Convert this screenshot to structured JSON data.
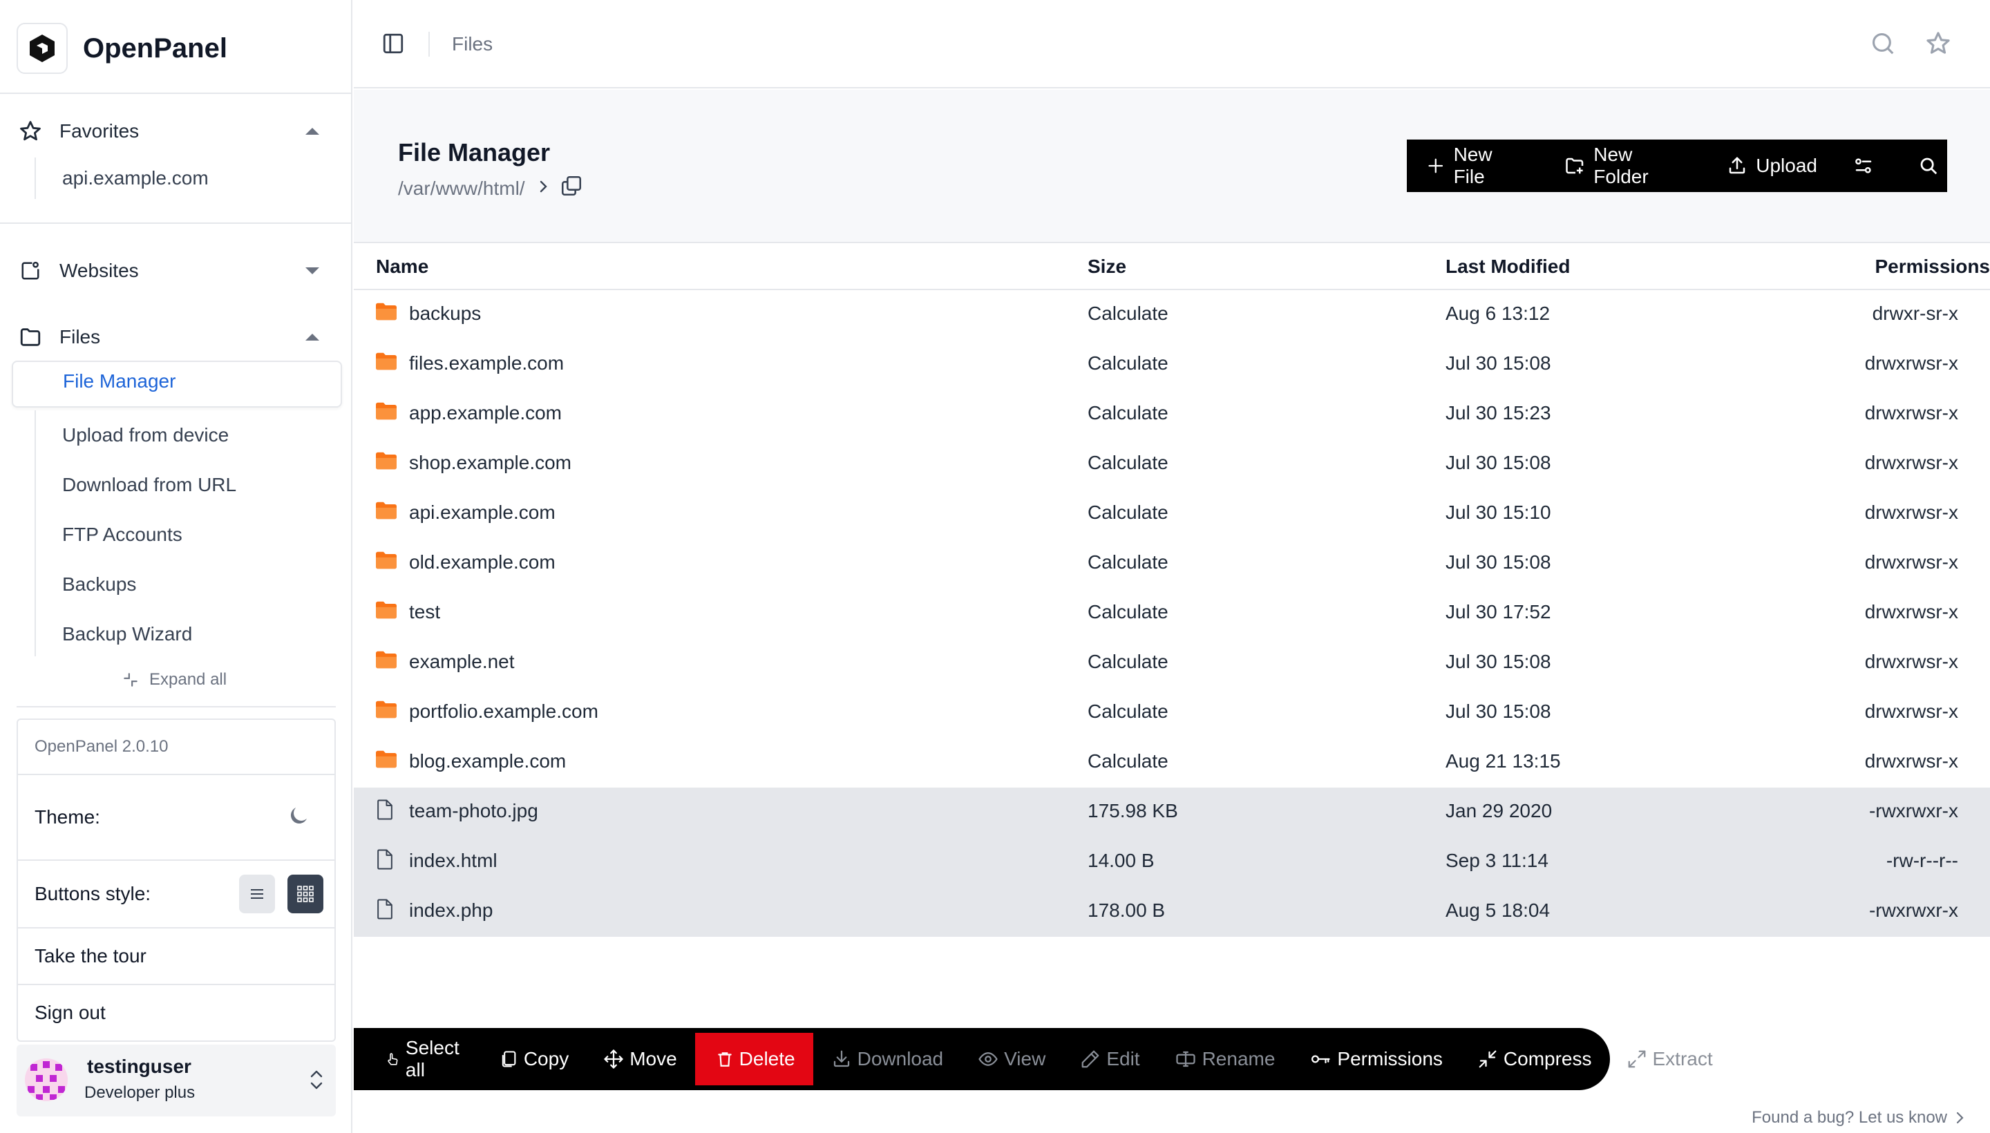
{
  "brand": {
    "name": "OpenPanel"
  },
  "sidebar": {
    "favorites": {
      "label": "Favorites",
      "items": [
        "api.example.com"
      ]
    },
    "websites": {
      "label": "Websites"
    },
    "files": {
      "label": "Files",
      "active": "File Manager",
      "items": [
        "Upload from device",
        "Download from URL",
        "FTP Accounts",
        "Backups",
        "Backup Wizard"
      ]
    },
    "expand_all": "Expand all",
    "settings": {
      "version": "OpenPanel 2.0.10",
      "theme_label": "Theme:",
      "buttons_style_label": "Buttons style:",
      "tour": "Take the tour",
      "signout": "Sign out"
    },
    "user": {
      "name": "testinguser",
      "plan": "Developer plus"
    }
  },
  "topbar": {
    "breadcrumb": "Files"
  },
  "header": {
    "title": "File Manager",
    "path": "/var/www/html/",
    "actions": {
      "new_file": "New File",
      "new_folder": "New Folder",
      "upload": "Upload"
    }
  },
  "table": {
    "columns": {
      "name": "Name",
      "size": "Size",
      "modified": "Last Modified",
      "permissions": "Permissions"
    },
    "rows": [
      {
        "type": "folder",
        "name": "backups",
        "size": "Calculate",
        "modified": "Aug 6 13:12",
        "permissions": "drwxr-sr-x"
      },
      {
        "type": "folder",
        "name": "files.example.com",
        "size": "Calculate",
        "modified": "Jul 30 15:08",
        "permissions": "drwxrwsr-x"
      },
      {
        "type": "folder",
        "name": "app.example.com",
        "size": "Calculate",
        "modified": "Jul 30 15:23",
        "permissions": "drwxrwsr-x"
      },
      {
        "type": "folder",
        "name": "shop.example.com",
        "size": "Calculate",
        "modified": "Jul 30 15:08",
        "permissions": "drwxrwsr-x"
      },
      {
        "type": "folder",
        "name": "api.example.com",
        "size": "Calculate",
        "modified": "Jul 30 15:10",
        "permissions": "drwxrwsr-x"
      },
      {
        "type": "folder",
        "name": "old.example.com",
        "size": "Calculate",
        "modified": "Jul 30 15:08",
        "permissions": "drwxrwsr-x"
      },
      {
        "type": "folder",
        "name": "test",
        "size": "Calculate",
        "modified": "Jul 30 17:52",
        "permissions": "drwxrwsr-x"
      },
      {
        "type": "folder",
        "name": "example.net",
        "size": "Calculate",
        "modified": "Jul 30 15:08",
        "permissions": "drwxrwsr-x"
      },
      {
        "type": "folder",
        "name": "portfolio.example.com",
        "size": "Calculate",
        "modified": "Jul 30 15:08",
        "permissions": "drwxrwsr-x"
      },
      {
        "type": "folder",
        "name": "blog.example.com",
        "size": "Calculate",
        "modified": "Aug 21 13:15",
        "permissions": "drwxrwsr-x"
      },
      {
        "type": "file",
        "name": "team-photo.jpg",
        "size": "175.98 KB",
        "modified": "Jan 29 2020",
        "permissions": "-rwxrwxr-x"
      },
      {
        "type": "file",
        "name": "index.html",
        "size": "14.00 B",
        "modified": "Sep 3 11:14",
        "permissions": "-rw-r--r--"
      },
      {
        "type": "file",
        "name": "index.php",
        "size": "178.00 B",
        "modified": "Aug 5 18:04",
        "permissions": "-rwxrwxr-x"
      }
    ]
  },
  "actionbar": {
    "select_all": "Select all",
    "copy": "Copy",
    "move": "Move",
    "delete": "Delete",
    "download": "Download",
    "view": "View",
    "edit": "Edit",
    "rename": "Rename",
    "permissions": "Permissions",
    "compress": "Compress",
    "extract": "Extract"
  },
  "footer": {
    "bug": "Found a bug? Let us know"
  },
  "colors": {
    "accent": "#1d64d8",
    "folder": "#f97316",
    "danger": "#e30613",
    "toolbar": "#000000",
    "selected_row": "#e5e7eb"
  }
}
